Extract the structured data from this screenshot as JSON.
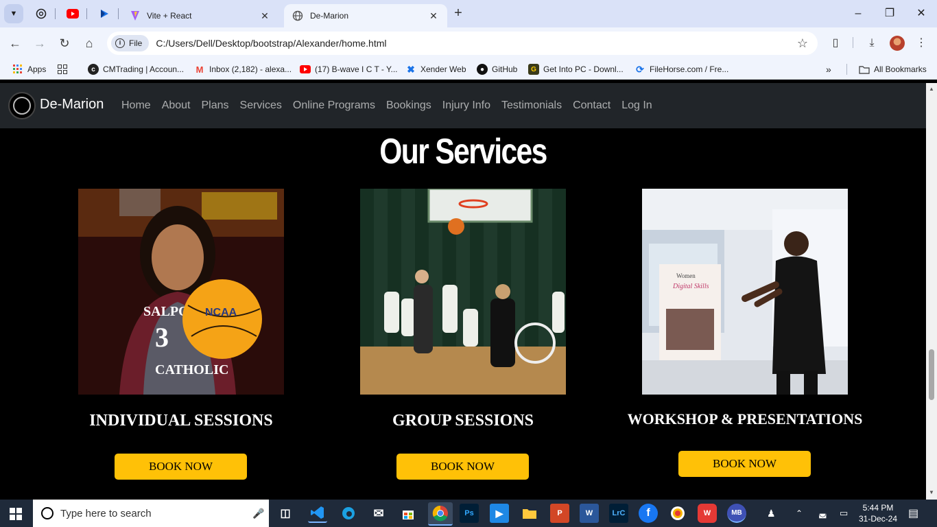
{
  "browser": {
    "tabs": [
      {
        "title": "Vite + React",
        "active": false
      },
      {
        "title": "De-Marion",
        "active": true
      }
    ],
    "address": {
      "scheme_label": "File",
      "url": "C:/Users/Dell/Desktop/bootstrap/Alexander/home.html"
    },
    "bookmarks": [
      {
        "label": "Apps",
        "icon": "apps-grid-icon"
      },
      {
        "label": "",
        "icon": "grid-icon"
      },
      {
        "label": "CMTrading | Accoun...",
        "icon": "cmtrading-icon"
      },
      {
        "label": "Inbox (2,182) - alexa...",
        "icon": "gmail-icon"
      },
      {
        "label": "(17) B-wave I C T - Y...",
        "icon": "youtube-icon"
      },
      {
        "label": "Xender Web",
        "icon": "xender-icon"
      },
      {
        "label": "GitHub",
        "icon": "github-icon"
      },
      {
        "label": "Get Into PC - Downl...",
        "icon": "getintopc-icon"
      },
      {
        "label": "FileHorse.com / Fre...",
        "icon": "filehorse-icon"
      }
    ],
    "all_bookmarks_label": "All Bookmarks"
  },
  "site": {
    "brand": "De-Marion",
    "nav": [
      "Home",
      "About",
      "Plans",
      "Services",
      "Online Programs",
      "Bookings",
      "Injury Info",
      "Testimonials",
      "Contact",
      "Log In"
    ],
    "section_title": "Our Services",
    "services": [
      {
        "title": "INDIVIDUAL SESSIONS",
        "button": "BOOK NOW",
        "image": "basketball-player-photo"
      },
      {
        "title": "GROUP SESSIONS",
        "button": "BOOK NOW",
        "image": "group-basketball-photo"
      },
      {
        "title": "WORKSHOP & PRESENTATIONS",
        "button": "BOOK NOW",
        "image": "workshop-presenter-photo"
      }
    ]
  },
  "taskbar": {
    "search_placeholder": "Type here to search",
    "time": "5:44 PM",
    "date": "31-Dec-24"
  },
  "colors": {
    "accent": "#ffc107",
    "navbar": "#212529",
    "chrome": "#dae2f8"
  }
}
